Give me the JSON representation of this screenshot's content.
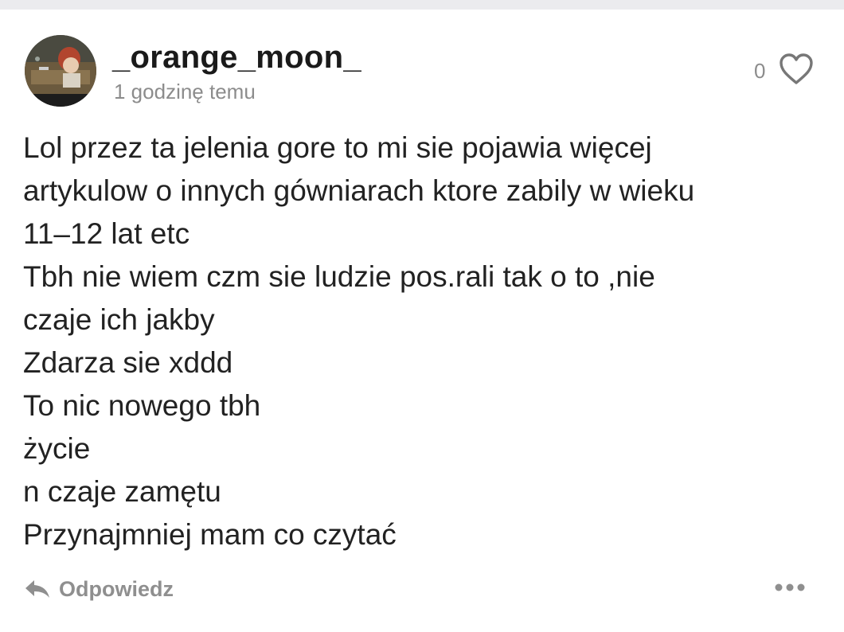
{
  "comment": {
    "username": "_orange_moon_",
    "timestamp": "1 godzinę temu",
    "like_count": "0",
    "like_icon": "heart-outline-icon",
    "body_lines": [
      "Lol przez ta jelenia gore to mi sie pojawia więcej",
      "artykulow o innych gówniarach ktore zabily w wieku",
      "11–12 lat etc",
      "Tbh nie wiem czm sie ludzie pos.rali tak o to ,nie",
      "czaje ich jakby",
      "Zdarza sie xddd",
      "To nic nowego tbh",
      "życie",
      "n czaje zamętu",
      "Przynajmniej mam co czytać"
    ],
    "reply_label": "Odpowiedz",
    "reply_icon": "reply-arrow-icon",
    "more_icon": "more-horizontal-icon"
  },
  "colors": {
    "username": "#1a1a1a",
    "body_text": "#222222",
    "muted": "#8c8c8c",
    "top_strip": "#ebebee"
  }
}
